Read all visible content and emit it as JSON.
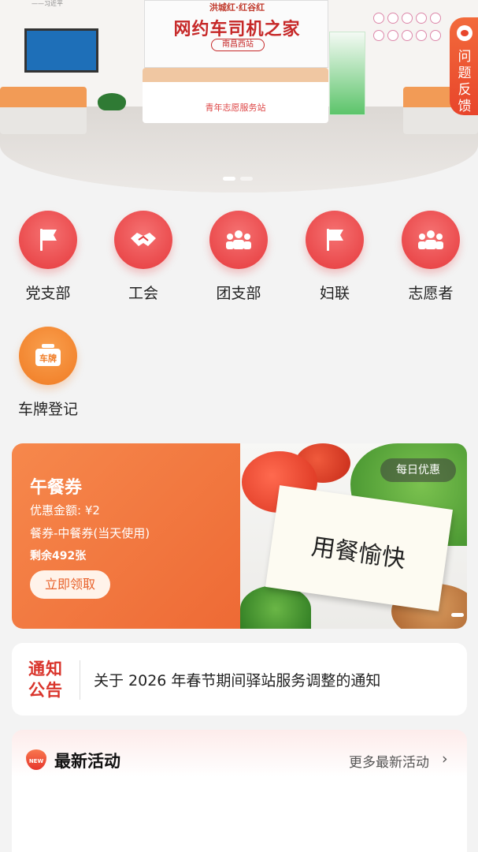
{
  "hero": {
    "sign_top": "洪城红·红谷红",
    "sign_main": "网约车司机之家",
    "sign_sub": "南昌西站",
    "desk_text": "青年志愿服务站",
    "wall_quote": "——习近平"
  },
  "feedback": {
    "label": "问题反馈",
    "icon": "headset-icon"
  },
  "categories": [
    {
      "label": "党支部",
      "icon": "flag-icon",
      "color": "#e6393c"
    },
    {
      "label": "工会",
      "icon": "handshake-icon",
      "color": "#e6393c"
    },
    {
      "label": "团支部",
      "icon": "group-icon",
      "color": "#e6393c"
    },
    {
      "label": "妇联",
      "icon": "flag-icon",
      "color": "#e6393c"
    },
    {
      "label": "志愿者",
      "icon": "group-icon",
      "color": "#e6393c"
    },
    {
      "label": "车牌登记",
      "icon": "license-plate-icon",
      "icon_text": "车牌",
      "color": "#f07a22"
    }
  ],
  "coupon": {
    "title": "午餐券",
    "amount": "优惠金额: ¥2",
    "type": "餐券-中餐券(当天使用)",
    "remaining": "剩余492张",
    "claim_button": "立即领取",
    "daily_tag": "每日优惠",
    "image_text": "用餐愉快",
    "accent": "#ee6a35"
  },
  "notice": {
    "badge": "通知公告",
    "text": "关于 2026 年春节期间驿站服务调整的通知"
  },
  "activities": {
    "icon_text": "NEW",
    "title": "最新活动",
    "more": "更多最新活动"
  }
}
